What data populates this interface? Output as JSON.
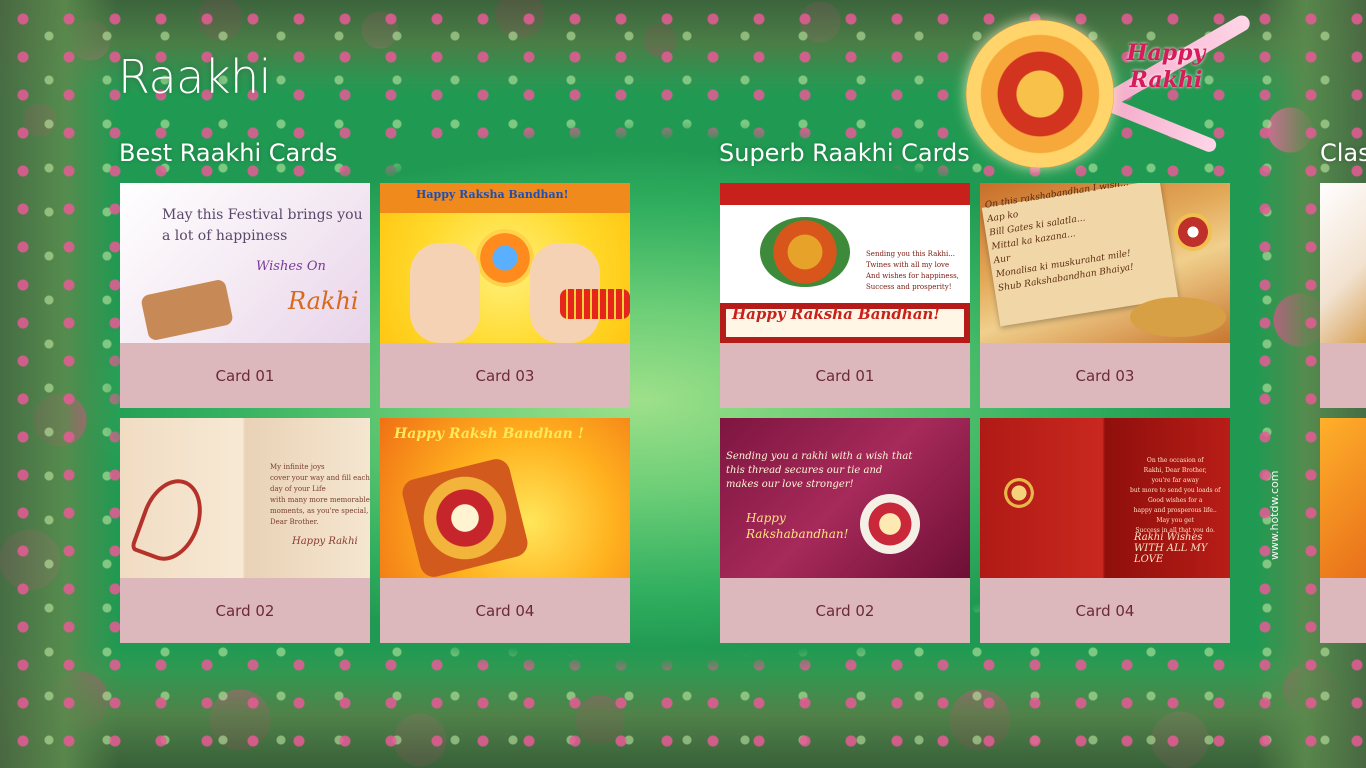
{
  "app": {
    "title": "Raakhi"
  },
  "decoration": {
    "greeting": "Happy\nRakhi"
  },
  "groups": [
    {
      "title": "Best Raakhi Cards",
      "cards": [
        {
          "label": "Card 01",
          "text": "May this Festival brings you\na lot of happiness",
          "subtext": "Wishes On",
          "signature": "Rakhi"
        },
        {
          "label": "Card 03",
          "text": "Happy Raksha Bandhan!"
        },
        {
          "label": "Card 02",
          "text": "My infinite joys\ncover your way and fill each\nday of your Life\nwith many more memorable\nmoments, as you're special,\nDear Brother.",
          "signature": "Happy Rakhi"
        },
        {
          "label": "Card 04",
          "text": "Happy Raksh Bandhan !"
        }
      ]
    },
    {
      "title": "Superb Raakhi Cards",
      "cards": [
        {
          "label": "Card 01",
          "text": "Sending you this Rakhi...\nTwines with all my love\nAnd wishes for happiness,\nSuccess and prosperity!",
          "signature": "Happy Raksha Bandhan!"
        },
        {
          "label": "Card 03",
          "text": "On this rakshabandhan I wish...\nAap ko\nBill Gates ki salatla...\nMittal ka kazana...\nAur\nMonalisa ki muskurahat mile!\nShub Rakshabandhan Bhaiya!"
        },
        {
          "label": "Card 02",
          "text": "Sending you a rakhi with a wish that\nthis thread secures our tie and\nmakes our love stronger!",
          "signature": "Happy\nRakshabandhan!"
        },
        {
          "label": "Card 04",
          "text": "On the occasion of\nRakhi, Dear Brother,\nyou're far away\nbut more to send you loads of\nGood wishes for a\nhappy and prosperous life..\nMay you get\nSuccess in all that you do.",
          "signature": "Rakhi Wishes\nWITH ALL MY LOVE"
        }
      ]
    },
    {
      "title": "Clas"
    }
  ],
  "watermark": "www.hotdw.com",
  "colors": {
    "tile_label_bg": "#dcb7bc",
    "tile_label_text": "#6b2a3a",
    "title_text": "#ffffff"
  }
}
